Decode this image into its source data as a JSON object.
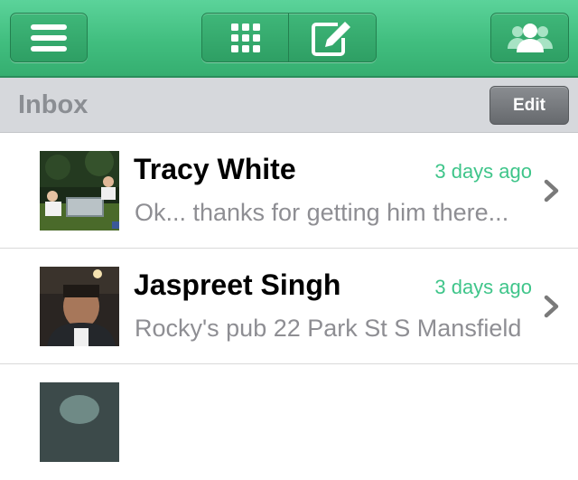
{
  "toolbar": {
    "menu_icon": "hamburger-menu-icon",
    "grid_icon": "apps-grid-icon",
    "compose_icon": "compose-icon",
    "contacts_icon": "contacts-group-icon",
    "accent_color": "#41be7f"
  },
  "inbox": {
    "title": "Inbox",
    "edit_label": "Edit"
  },
  "messages": [
    {
      "sender": "Tracy White",
      "time": "3 days ago",
      "preview": "Ok... thanks for getting him there..."
    },
    {
      "sender": "Jaspreet Singh",
      "time": "3 days ago",
      "preview": "Rocky's pub 22 Park St S Mansfield"
    },
    {
      "sender": "",
      "time": "",
      "preview": ""
    }
  ],
  "colors": {
    "time_text": "#3fc58a",
    "preview_text": "#8e8e93",
    "header_bg": "#d6d8dc"
  }
}
